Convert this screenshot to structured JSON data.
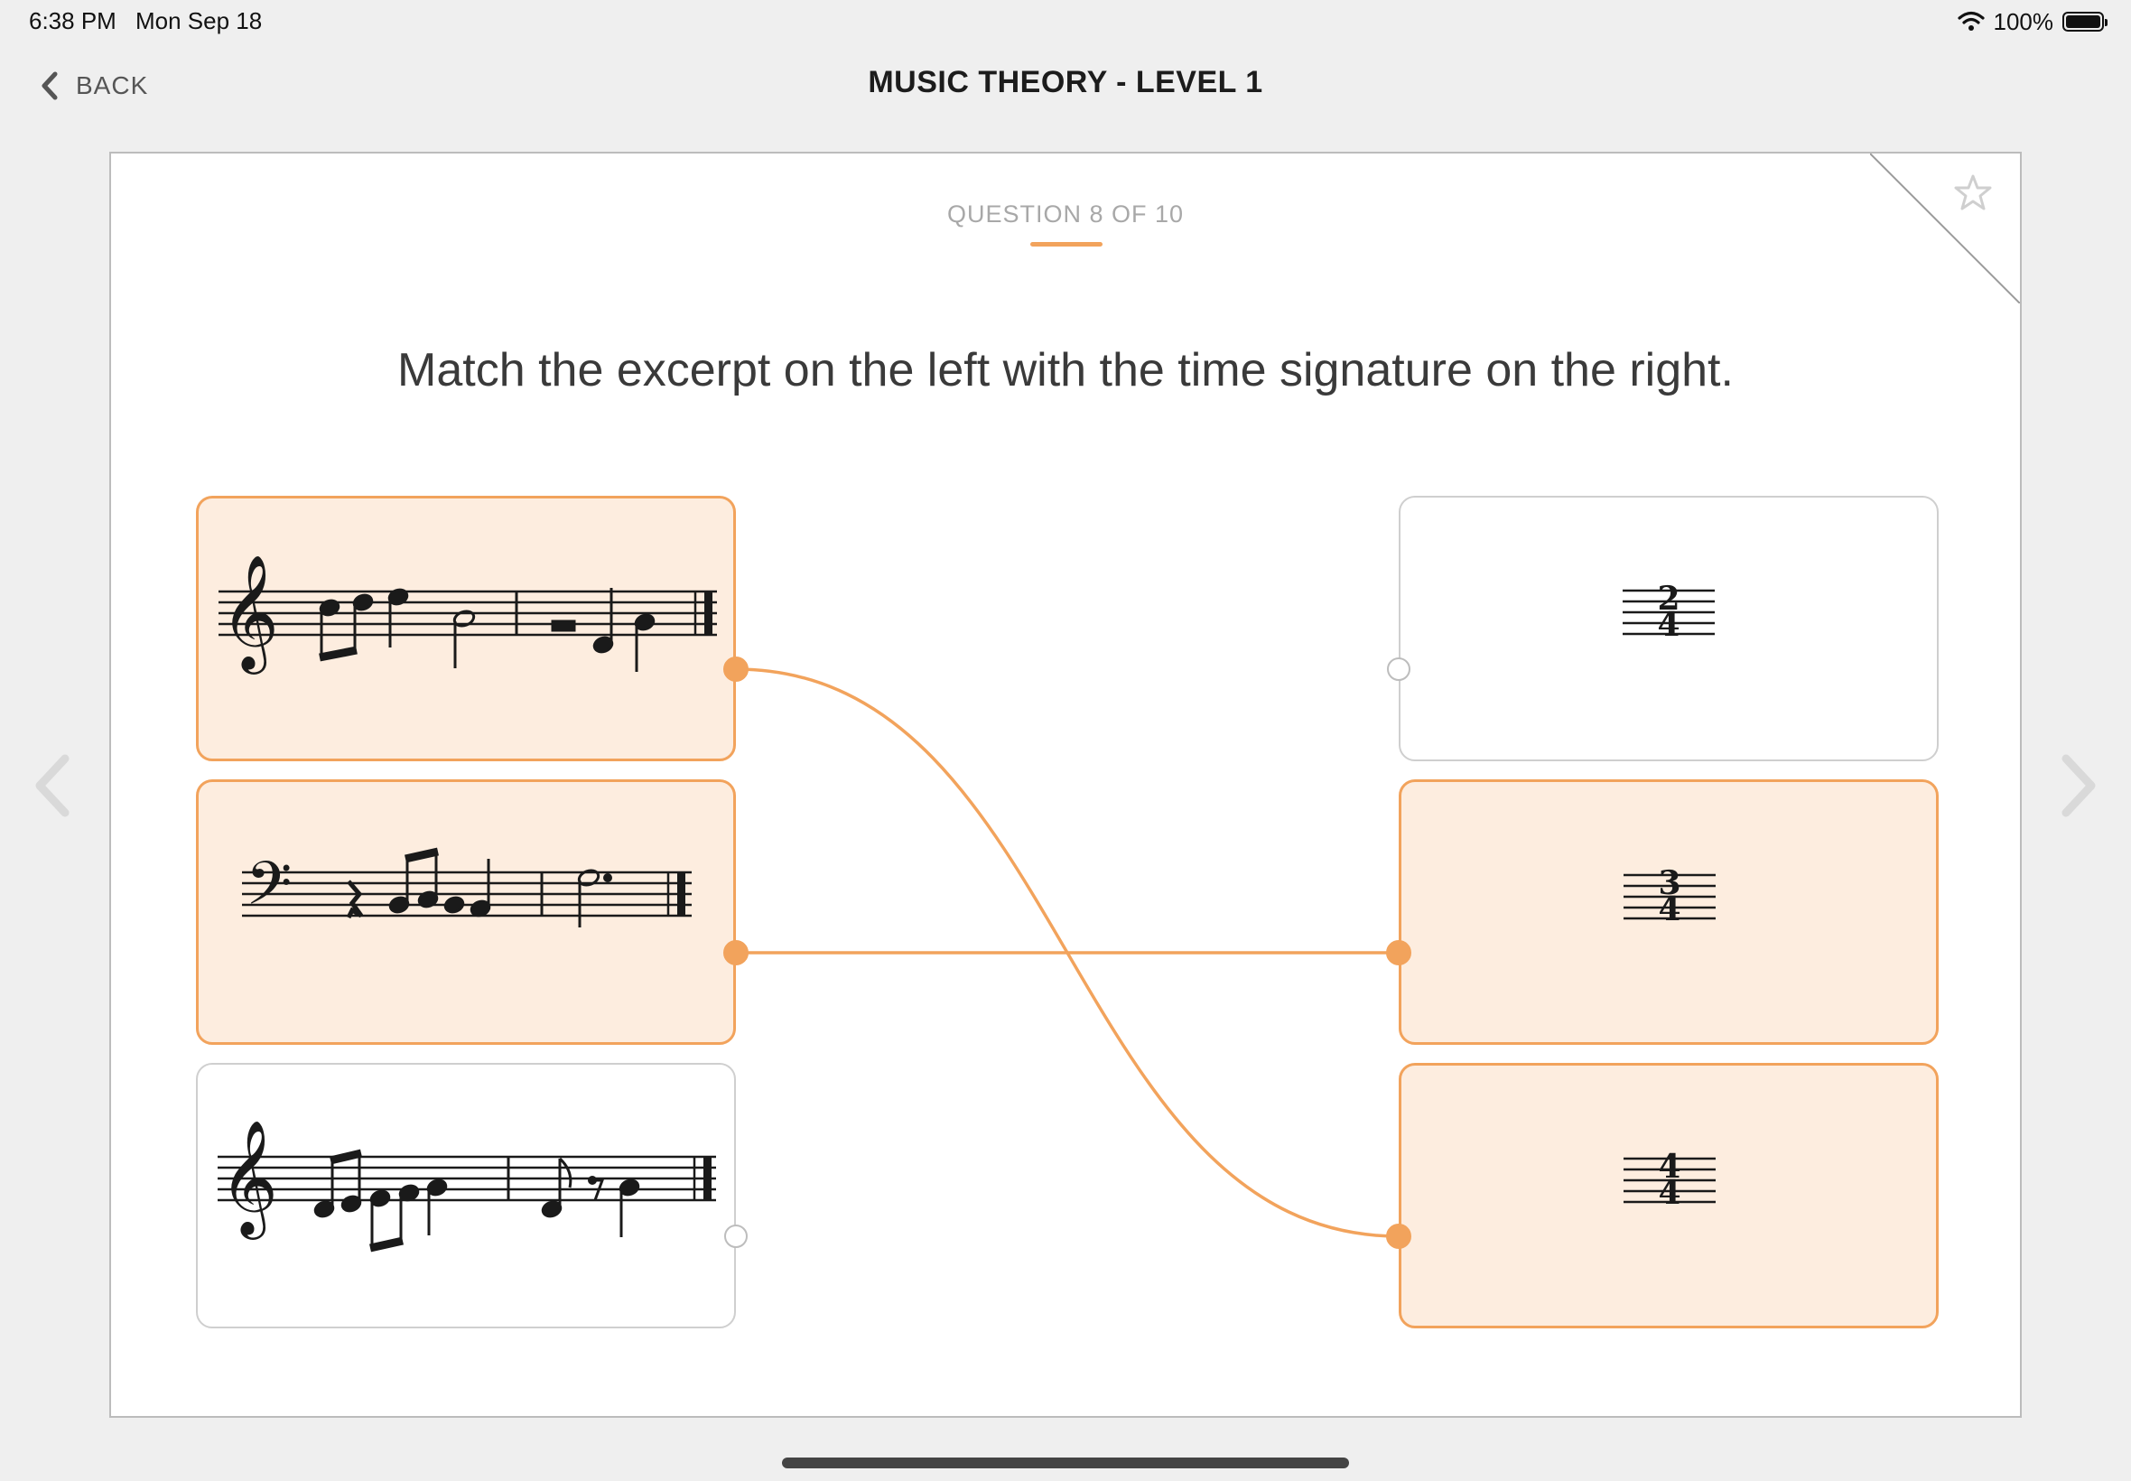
{
  "status_bar": {
    "time": "6:38 PM",
    "date": "Mon Sep 18",
    "battery": "100%"
  },
  "nav": {
    "back_label": "BACK",
    "title": "MUSIC THEORY - LEVEL 1"
  },
  "question": {
    "counter": "QUESTION 8 OF 10",
    "prompt": "Match the excerpt on the left with the time signature on the right."
  },
  "left_items": [
    {
      "id": "excerpt-1",
      "clef": "treble",
      "selected": true
    },
    {
      "id": "excerpt-2",
      "clef": "bass",
      "selected": true
    },
    {
      "id": "excerpt-3",
      "clef": "treble",
      "selected": false
    }
  ],
  "right_items": [
    {
      "id": "time-sig-2-4",
      "top": "2",
      "bottom": "4",
      "selected": false
    },
    {
      "id": "time-sig-3-4",
      "top": "3",
      "bottom": "4",
      "selected": true
    },
    {
      "id": "time-sig-4-4",
      "top": "4",
      "bottom": "4",
      "selected": true
    }
  ],
  "matches": [
    {
      "from": 0,
      "to": 2
    },
    {
      "from": 1,
      "to": 1
    }
  ],
  "colors": {
    "accent": "#f2a35c",
    "selected_fill": "#fdeddf",
    "border": "#cfcfcf"
  }
}
